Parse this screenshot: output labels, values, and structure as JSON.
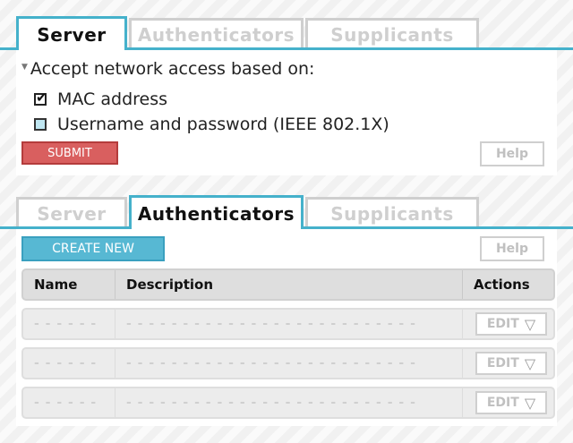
{
  "server_panel": {
    "tabs": [
      "Server",
      "Authenticators",
      "Supplicants"
    ],
    "active_tab": 0,
    "section_title": "Accept network access based on:",
    "options": [
      {
        "label": "MAC address",
        "checked": true
      },
      {
        "label": "Username and password (IEEE 802.1X)",
        "checked": false
      }
    ],
    "submit_label": "SUBMIT",
    "help_label": "Help"
  },
  "auth_panel": {
    "tabs": [
      "Server",
      "Authenticators",
      "Supplicants"
    ],
    "active_tab": 1,
    "create_label": "CREATE NEW",
    "help_label": "Help",
    "columns": [
      "Name",
      "Description",
      "Actions"
    ],
    "rows": [
      {
        "name": "- - - - - -",
        "description": "- - - - - - - - - - - - - - - - - - - - - - - - - -",
        "action": "EDIT"
      },
      {
        "name": "- - - - - -",
        "description": "- - - - - - - - - - - - - - - - - - - - - - - - - -",
        "action": "EDIT"
      },
      {
        "name": "- - - - - -",
        "description": "- - - - - - - - - - - - - - - - - - - - - - - - - -",
        "action": "EDIT"
      }
    ]
  },
  "icons": {
    "caret": "caret-down-icon",
    "checkbox_checked": "checkbox-checked-icon",
    "checkbox_unchecked": "checkbox-unchecked-icon",
    "dropdown": "triangle-down-icon"
  },
  "colors": {
    "accent": "#45b1cb",
    "submit": "#d95f5f",
    "create": "#57b8d3"
  }
}
